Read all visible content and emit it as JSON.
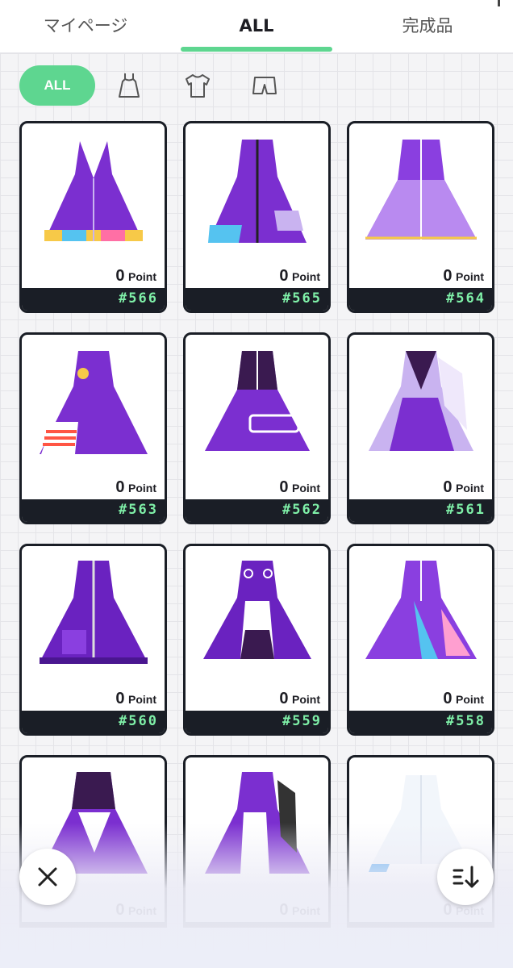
{
  "tabs": [
    {
      "label": "マイページ",
      "active": false
    },
    {
      "label": "ALL",
      "active": true
    },
    {
      "label": "完成品",
      "active": false
    }
  ],
  "filters": {
    "all_label": "ALL",
    "icons": [
      "dress-icon",
      "shirt-icon",
      "shorts-icon"
    ]
  },
  "cards": [
    {
      "points": "0",
      "unit": "Point",
      "id": "#566"
    },
    {
      "points": "0",
      "unit": "Point",
      "id": "#565"
    },
    {
      "points": "0",
      "unit": "Point",
      "id": "#564"
    },
    {
      "points": "0",
      "unit": "Point",
      "id": "#563"
    },
    {
      "points": "0",
      "unit": "Point",
      "id": "#562"
    },
    {
      "points": "0",
      "unit": "Point",
      "id": "#561"
    },
    {
      "points": "0",
      "unit": "Point",
      "id": "#560"
    },
    {
      "points": "0",
      "unit": "Point",
      "id": "#559"
    },
    {
      "points": "0",
      "unit": "Point",
      "id": "#558"
    },
    {
      "points": "0",
      "unit": "Point",
      "id": ""
    },
    {
      "points": "0",
      "unit": "Point",
      "id": ""
    },
    {
      "points": "0",
      "unit": "Point",
      "id": ""
    }
  ],
  "buttons": {
    "close_icon": "close-icon",
    "sort_icon": "sort-icon"
  },
  "colors": {
    "accent": "#5ed690",
    "card_dark": "#1a1e26",
    "id_green": "#7ff0a8",
    "outfit_purple": "#7b2fd0"
  }
}
